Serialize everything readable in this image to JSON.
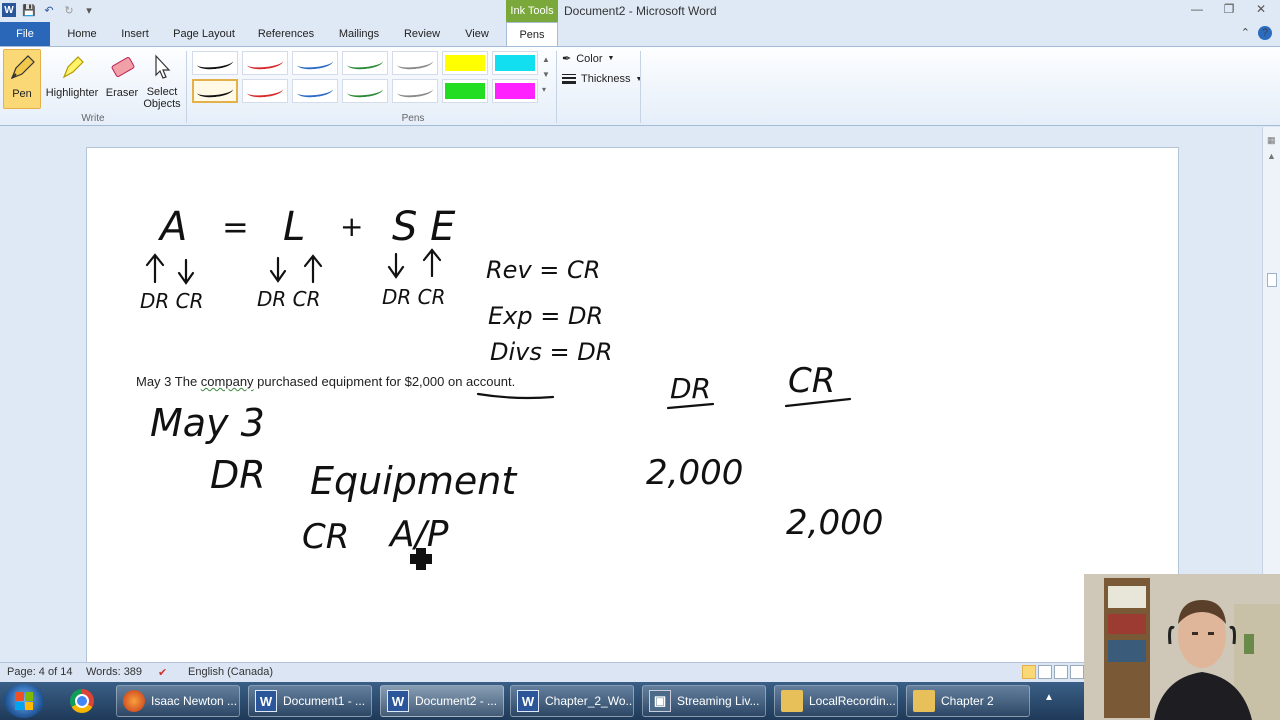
{
  "window": {
    "title": "Document2 - Microsoft Word",
    "context_tab": "Ink Tools"
  },
  "qat": {
    "icons": [
      "word-icon",
      "save-icon",
      "undo-icon",
      "redo-icon",
      "customize-icon"
    ]
  },
  "tabs": {
    "file": "File",
    "home": "Home",
    "insert": "Insert",
    "page_layout": "Page Layout",
    "references": "References",
    "mailings": "Mailings",
    "review": "Review",
    "view": "View",
    "pens": "Pens"
  },
  "ribbon": {
    "write": {
      "pen": "Pen",
      "highlighter": "Highlighter",
      "eraser": "Eraser",
      "select_line1": "Select",
      "select_line2": "Objects",
      "group": "Write"
    },
    "pens_group": "Pens",
    "color": "Color",
    "thickness": "Thickness",
    "pen_colors_row1": [
      "#111111",
      "#d92b2b",
      "#2f6dc8",
      "#2e8b3a",
      "#8a8a8a"
    ],
    "pen_colors_row2": [
      "#111111",
      "#d92b2b",
      "#2f6dc8",
      "#2e8b3a",
      "#8a8a8a"
    ],
    "highlighter_colors_row1": [
      "#ffff00",
      "#12e0f0"
    ],
    "highlighter_colors_row2": [
      "#22dd22",
      "#ff22ff"
    ]
  },
  "document": {
    "typed": {
      "prefix": "May 3   The ",
      "company": "company",
      "middle": " purchased equipment for $2,000 ",
      "on_account": "on account."
    },
    "ink": {
      "eq_a": "A",
      "eq_equals": "=",
      "eq_l": "L",
      "eq_plus": "+",
      "eq_se": "S E",
      "dr_cr_a": "DR CR",
      "dr_cr_l": "DR  CR",
      "dr_cr_se": "DR CR",
      "rev": "Rev = CR",
      "exp": "Exp = DR",
      "divs": "Divs = DR",
      "col_dr": "DR",
      "col_cr": "CR",
      "date": "May 3",
      "dr": "DR",
      "equipment": "Equipment",
      "cr": "CR",
      "ap": "A/P",
      "amt_dr": "2,000",
      "amt_cr": "2,000"
    }
  },
  "status": {
    "page": "Page: 4 of 14",
    "words": "Words: 389",
    "language": "English (Canada)"
  },
  "taskbar": {
    "items": [
      {
        "label": "Isaac Newton ...",
        "icon": "firefox-icon"
      },
      {
        "label": "Document1 - ...",
        "icon": "word-icon"
      },
      {
        "label": "Document2 - ...",
        "icon": "word-icon"
      },
      {
        "label": "Chapter_2_Wo...",
        "icon": "word-icon"
      },
      {
        "label": "Streaming Liv...",
        "icon": "stream-icon"
      },
      {
        "label": "LocalRecordin...",
        "icon": "folder-icon"
      },
      {
        "label": "Chapter 2",
        "icon": "folder-icon"
      }
    ]
  }
}
